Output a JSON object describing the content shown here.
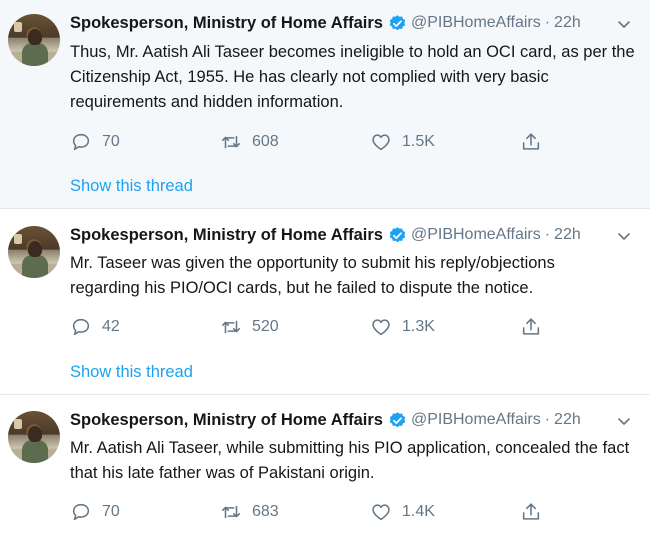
{
  "tweets": [
    {
      "author_name": "Spokesperson, Ministry of Home Affairs",
      "handle": "@PIBHomeAffairs",
      "separator": "·",
      "time": "22h",
      "lines": [
        "Thus, Mr. Aatish Ali Taseer becomes ineligible to hold an OCI card, as per the",
        "Citizenship Act, 1955. He has clearly not complied with very basic",
        "requirements and hidden information."
      ],
      "replies": "70",
      "retweets": "608",
      "likes": "1.5K",
      "thread_link": "Show this thread"
    },
    {
      "author_name": "Spokesperson, Ministry of Home Affairs",
      "handle": "@PIBHomeAffairs",
      "separator": "·",
      "time": "22h",
      "lines": [
        "Mr. Taseer was given the opportunity to submit his reply/objections",
        "regarding his PIO/OCI cards, but he failed to dispute the notice."
      ],
      "replies": "42",
      "retweets": "520",
      "likes": "1.3K",
      "thread_link": "Show this thread"
    },
    {
      "author_name": "Spokesperson, Ministry of Home Affairs",
      "handle": "@PIBHomeAffairs",
      "separator": "·",
      "time": "22h",
      "lines": [
        "Mr. Aatish Ali Taseer, while submitting his PIO application, concealed the fact",
        "that his late father was of Pakistani origin."
      ],
      "replies": "70",
      "retweets": "683",
      "likes": "1.4K"
    }
  ],
  "icons": {
    "verified": "verified-badge-icon",
    "caret": "chevron-down-icon",
    "reply": "reply-bubble-icon",
    "retweet": "retweet-icon",
    "like": "heart-icon",
    "share": "share-icon"
  },
  "colors": {
    "accent": "#1da1f2",
    "muted": "#657786",
    "highlight_bg": "#f5f8fa"
  }
}
